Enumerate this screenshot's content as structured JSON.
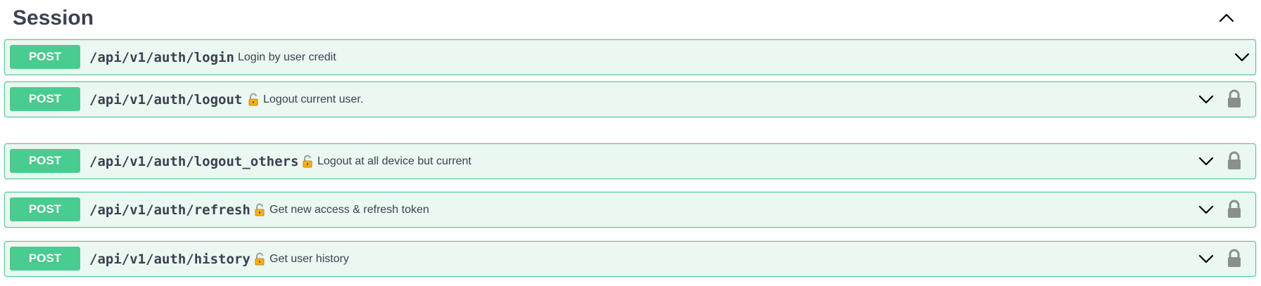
{
  "section": {
    "title": "Session",
    "collapse_icon": "chevron-up-icon"
  },
  "operations": [
    {
      "method": "POST",
      "path": "/api/v1/auth/login",
      "description": "Login by user credit",
      "locked": false
    },
    {
      "method": "POST",
      "path": "/api/v1/auth/logout",
      "description": "Logout current user.",
      "locked": true
    },
    {
      "method": "POST",
      "path": "/api/v1/auth/logout_others",
      "description": "Logout at all device but current",
      "locked": true
    },
    {
      "method": "POST",
      "path": "/api/v1/auth/refresh",
      "description": "Get new access & refresh token",
      "locked": true
    },
    {
      "method": "POST",
      "path": "/api/v1/auth/history",
      "description": "Get user history",
      "locked": true
    }
  ],
  "colors": {
    "post_accent": "#49cc90",
    "post_background": "#ebf7f1",
    "text": "#3b4151",
    "lock_gray": "#8a8f8a",
    "open_lock_gold": "#e0a800"
  }
}
